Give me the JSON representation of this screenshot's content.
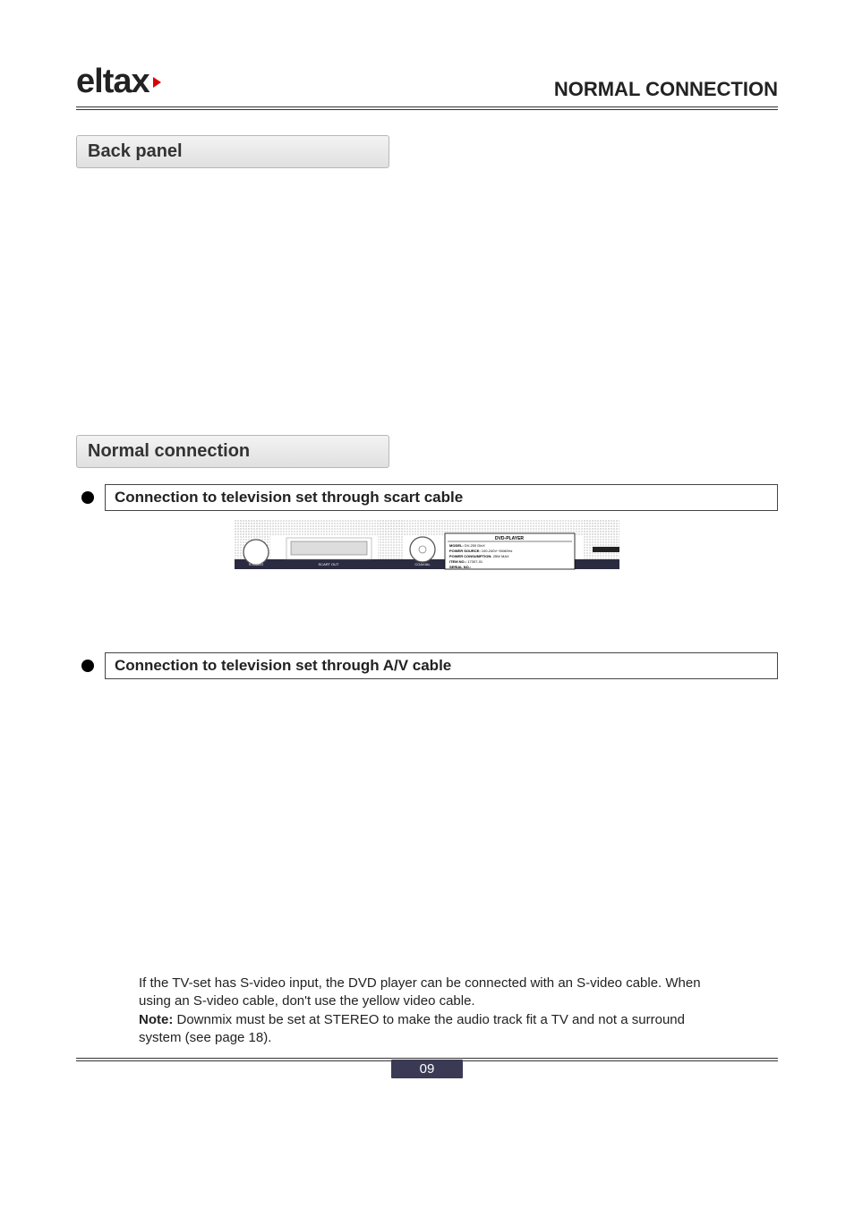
{
  "brand": "eltax",
  "header_title": "NORMAL CONNECTION",
  "sections": {
    "back_panel": "Back panel",
    "normal_connection": "Normal connection"
  },
  "subsections": {
    "scart": "Connection to television set through scart cable",
    "av": "Connection to television set through A/V cable"
  },
  "panel_labels": {
    "svideo": "S-VIDEO",
    "scart_out": "SCART OUT",
    "coaxial": "COAXIAL",
    "plate_title": "DVD-PLAYER",
    "plate_model_label": "MODEL:",
    "plate_model_value": "DV-200 DivX",
    "plate_power_label": "POWER SOURCE:",
    "plate_power_value": "100-240V~50/60Hz",
    "plate_consumption_label": "POWER CONSUMPTION:",
    "plate_consumption_value": "25W MAX",
    "plate_item_label": "ITEM NO.:",
    "plate_item_value": "17307-01",
    "plate_serial_label": "SERIAL NO.:"
  },
  "body": {
    "svideo_sentence": "If the TV-set has S-video input, the DVD player can be connected with an S-video cable. When using an S-video cable, don't use the yellow video cable.",
    "note_label": "Note:",
    "note_text": " Downmix must be set at STEREO to make the audio track fit a TV and not a surround system (see page 18)."
  },
  "page_number": "09"
}
